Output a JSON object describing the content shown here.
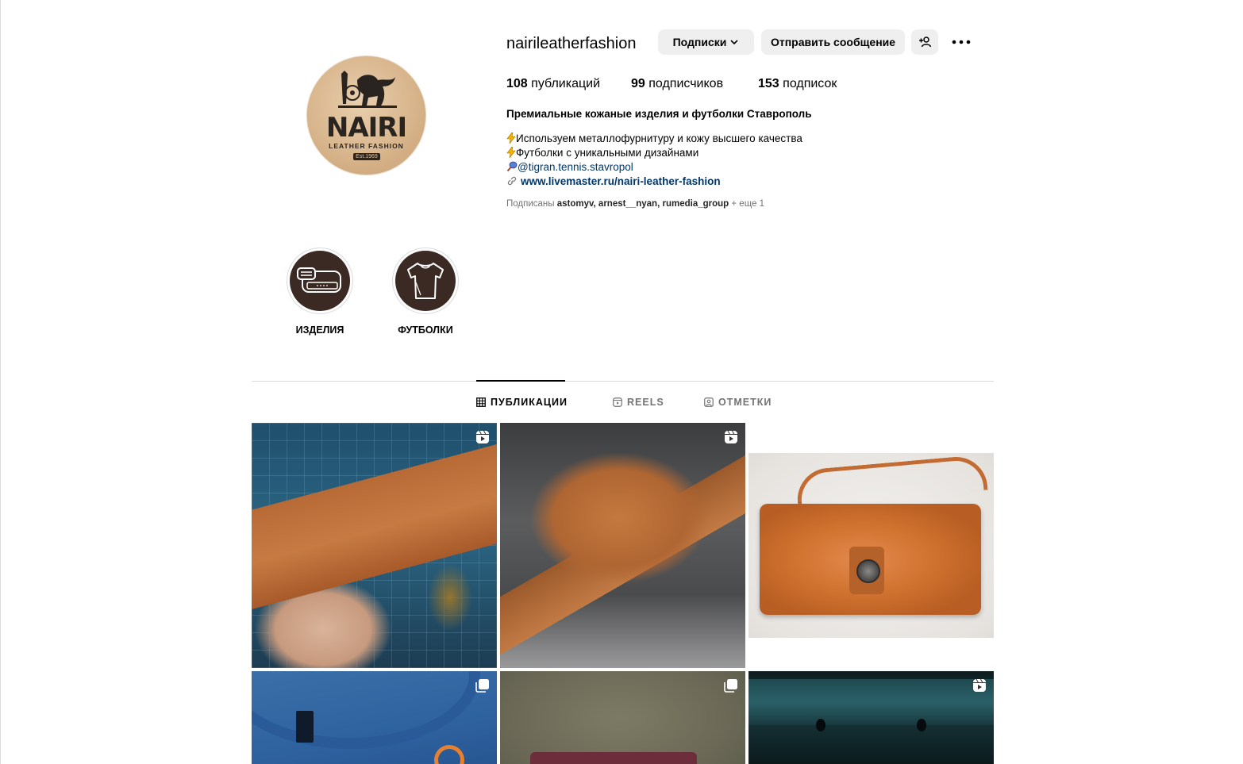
{
  "profile": {
    "username": "nairileatherfashion",
    "avatar_text": "NAIRI",
    "avatar_subtext": "LEATHER FASHION",
    "avatar_est": "Est.1969"
  },
  "actions": {
    "following_label": "Подписки",
    "message_label": "Отправить сообщение"
  },
  "stats": {
    "posts_count": "108",
    "posts_label": " публикаций",
    "followers_count": "99",
    "followers_label": " подписчиков",
    "following_count": "153",
    "following_label": " подписок"
  },
  "bio": {
    "full_name": "Премиальные кожаные изделия и футболки Ставрополь",
    "line1": "Используем металлофурнитуру и кожу высшего качества",
    "line2": "Футболки с уникальными дизайнами",
    "mention": "@tigran.tennis.stavropol",
    "link": "www.livemaster.ru/nairi-leather-fashion"
  },
  "followed_by": {
    "prefix": "Подписаны ",
    "names": "astomyv, arnest__nyan, rumedia_group",
    "suffix": " + еще 1"
  },
  "highlights": [
    {
      "label": "ИЗДЕЛИЯ"
    },
    {
      "label": "ФУТБОЛКИ"
    }
  ],
  "tabs": [
    {
      "label": "ПУБЛИКАЦИИ",
      "active": true
    },
    {
      "label": "REELS",
      "active": false
    },
    {
      "label": "ОТМЕТКИ",
      "active": false
    }
  ],
  "posts": [
    {
      "type": "reel",
      "icon": "reel-icon"
    },
    {
      "type": "reel",
      "icon": "reel-icon"
    },
    {
      "type": "photo",
      "icon": ""
    },
    {
      "type": "carousel",
      "icon": "carousel-icon"
    },
    {
      "type": "carousel",
      "icon": "carousel-icon"
    },
    {
      "type": "reel",
      "icon": "reel-icon"
    }
  ],
  "colors": {
    "link": "#00376b",
    "muted": "#737373",
    "button_bg": "#efefef",
    "divider": "#dbdbdb"
  }
}
